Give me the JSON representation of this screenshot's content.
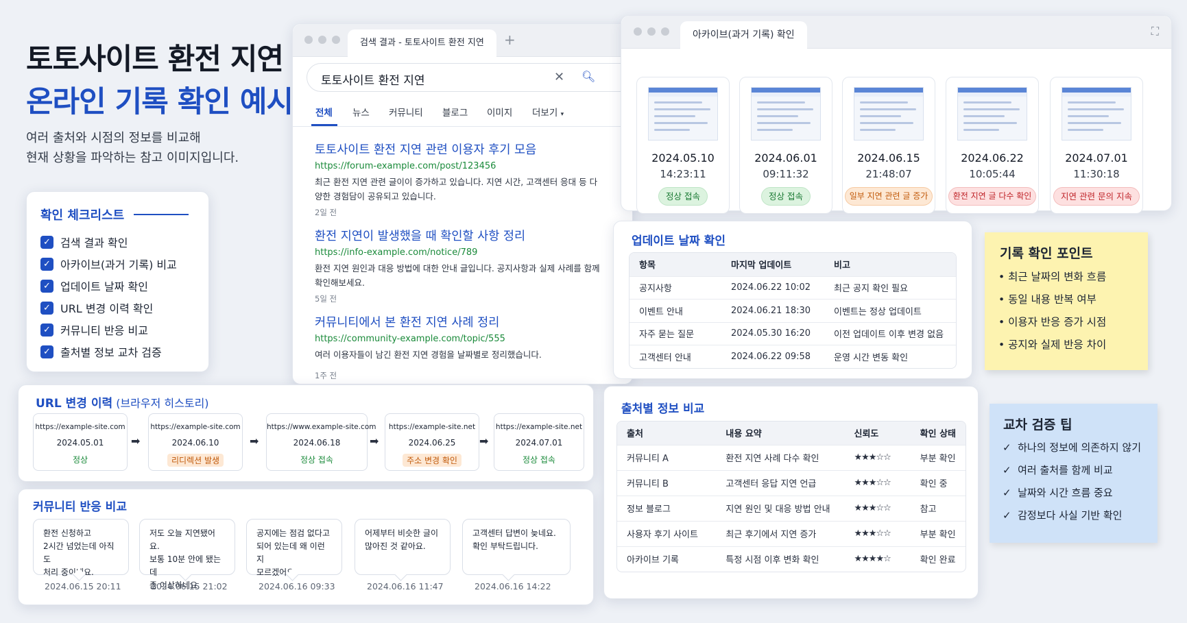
{
  "hero": {
    "title_line1": "토토사이트 환전 지연",
    "title_line2": "온라인 기록 확인 예시",
    "desc_line1": "여러 출처와 시점의 정보를 비교해",
    "desc_line2": "현재 상황을 파악하는 참고 이미지입니다."
  },
  "checklist": {
    "title": "확인 체크리스트",
    "items": [
      "검색 결과 확인",
      "아카이브(과거 기록) 비교",
      "업데이트 날짜 확인",
      "URL 변경 이력 확인",
      "커뮤니티 반응 비교",
      "출처별 정보 교차 검증"
    ]
  },
  "search": {
    "tab_title": "검색 결과 - 토토사이트 환전 지연",
    "query": "토토사이트 환전 지연",
    "tabs": [
      "전체",
      "뉴스",
      "커뮤니티",
      "블로그",
      "이미지",
      "더보기"
    ],
    "results": [
      {
        "title": "토토사이트 환전 지연 관련 이용자 후기 모음",
        "url": "https://forum-example.com/post/123456",
        "snippet": "최근 환전 지연 관련 글이이 증가하고 있습니다. 지연 시간, 고객센터 응대 등 다양한 경험담이 공유되고 있습니다.",
        "age": "2일 전"
      },
      {
        "title": "환전 지연이 발생했을 때 확인할 사항 정리",
        "url": "https://info-example.com/notice/789",
        "snippet": "환전 지연 원인과 대응 방법에 대한 안내 글입니다. 공지사항과 실제 사례를 함께 확인해보세요.",
        "age": "5일 전"
      },
      {
        "title": "커뮤니티에서 본 환전 지연 사례 정리",
        "url": "https://community-example.com/topic/555",
        "snippet": "여러 이용자들이 남긴 환전 지연 경험을 날짜별로 정리했습니다.",
        "age": "1주 전"
      }
    ]
  },
  "archive": {
    "tab_title": "아카이브(과거 기록) 확인",
    "snapshots": [
      {
        "date": "2024.05.10",
        "time": "14:23:11",
        "status": "정상 접속",
        "tone": "green"
      },
      {
        "date": "2024.06.01",
        "time": "09:11:32",
        "status": "정상 접속",
        "tone": "green"
      },
      {
        "date": "2024.06.15",
        "time": "21:48:07",
        "status": "일부 지연 관련 글 증가",
        "tone": "orange"
      },
      {
        "date": "2024.06.22",
        "time": "10:05:44",
        "status": "환전 지연 글 다수 확인",
        "tone": "red"
      },
      {
        "date": "2024.07.01",
        "time": "11:30:18",
        "status": "지연 관련 문의 지속",
        "tone": "red"
      }
    ]
  },
  "updates": {
    "title": "업데이트 날짜 확인",
    "headers": [
      "항목",
      "마지막 업데이트",
      "비고"
    ],
    "rows": [
      [
        "공지사항",
        "2024.06.22 10:02",
        "최근 공지 확인 필요"
      ],
      [
        "이벤트 안내",
        "2024.06.21 18:30",
        "이벤트는 정상 업데이트"
      ],
      [
        "자주 묻는 질문",
        "2024.05.30 16:20",
        "이전 업데이트 이후 변경 없음"
      ],
      [
        "고객센터 안내",
        "2024.06.22 09:58",
        "운영 시간 변동 확인"
      ]
    ]
  },
  "points": {
    "title": "기록 확인 포인트",
    "items": [
      "최근 날짜의 변화 흐름",
      "동일 내용 반복 여부",
      "이용자 반응 증가 시점",
      "공지와 실제 반응 차이"
    ]
  },
  "url_history": {
    "title": "URL 변경 이력",
    "subtitle": "(브라우저 히스토리)",
    "entries": [
      {
        "url": "https://example-site.com",
        "date": "2024.05.01",
        "status": "정상",
        "tone": "green"
      },
      {
        "url": "https://example-site.com",
        "date": "2024.06.10",
        "status": "리디렉션 발생",
        "tone": "orange"
      },
      {
        "url": "https://www.example-site.com",
        "date": "2024.06.18",
        "status": "정상 접속",
        "tone": "green"
      },
      {
        "url": "https://example-site.net",
        "date": "2024.06.25",
        "status": "주소 변경 확인",
        "tone": "orange"
      },
      {
        "url": "https://example-site.net",
        "date": "2024.07.01",
        "status": "정상 접속",
        "tone": "green"
      }
    ]
  },
  "sources": {
    "title": "출처별 정보 비교",
    "headers": [
      "출처",
      "내용 요약",
      "신뢰도",
      "확인 상태"
    ],
    "rows": [
      {
        "source": "커뮤니티 A",
        "summary": "환전 지연 사례 다수 확인",
        "stars": "★★★☆☆",
        "status": "부분 확인"
      },
      {
        "source": "커뮤니티 B",
        "summary": "고객센터 응답 지연 언급",
        "stars": "★★★☆☆",
        "status": "확인 중"
      },
      {
        "source": "정보 블로그",
        "summary": "지연 원인 및 대응 방법 안내",
        "stars": "★★★☆☆",
        "status": "참고"
      },
      {
        "source": "사용자 후기 사이트",
        "summary": "최근 후기에서 지연 증가",
        "stars": "★★★☆☆",
        "status": "부분 확인"
      },
      {
        "source": "아카이브 기록",
        "summary": "특정 시점 이후 변화 확인",
        "stars": "★★★★☆",
        "status": "확인 완료"
      }
    ]
  },
  "community": {
    "title": "커뮤니티 반응 비교",
    "posts": [
      {
        "lines": [
          "환전 신청하고",
          "2시간 넘었는데 아직도",
          "처리 중이네요."
        ],
        "ts": "2024.06.15 20:11"
      },
      {
        "lines": [
          "저도 오늘 지연됐어요.",
          "보통 10분 안에 됐는데",
          "좀 이상하네요."
        ],
        "ts": "2024.06.15 21:02"
      },
      {
        "lines": [
          "공지에는 점검 없다고",
          "되어 있는데 왜 이런지",
          "모르겠어요."
        ],
        "ts": "2024.06.16 09:33"
      },
      {
        "lines": [
          "어제부터 비슷한 글이",
          "많아진 것 같아요."
        ],
        "ts": "2024.06.16 11:47"
      },
      {
        "lines": [
          "고객센터 답변이 늦네요.",
          "확인 부탁드립니다."
        ],
        "ts": "2024.06.16 14:22"
      }
    ]
  },
  "tips": {
    "title": "교차 검증 팁",
    "items": [
      "하나의 정보에 의존하지 않기",
      "여러 출처를 함께 비교",
      "날짜와 시간 흐름 중요",
      "감정보다 사실 기반 확인"
    ]
  }
}
